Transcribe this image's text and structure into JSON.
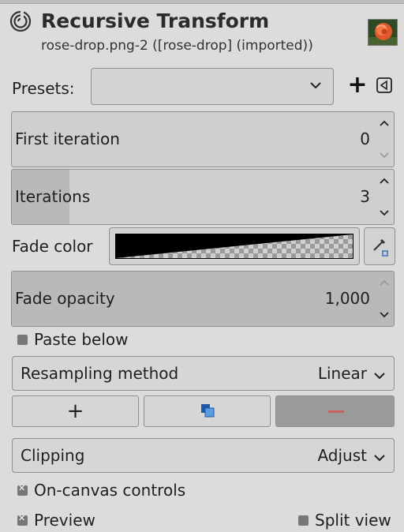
{
  "header": {
    "title": "Recursive Transform",
    "subtitle": "rose-drop.png-2 ([rose-drop] (imported))",
    "tool_icon": "spiral-icon",
    "thumbnail": "rose-thumbnail"
  },
  "presets": {
    "label": "Presets:",
    "value": "",
    "add_label": "+",
    "restore_icon": "restore-icon"
  },
  "first_iteration": {
    "label": "First iteration",
    "value": "0",
    "fraction": 0.0
  },
  "iterations": {
    "label": "Iterations",
    "value": "3",
    "fraction": 0.15
  },
  "fade_color": {
    "label": "Fade color",
    "color": "#000000",
    "picker_icon": "eyedropper-icon"
  },
  "fade_opacity": {
    "label": "Fade opacity",
    "value": "1,000",
    "fraction": 1.0
  },
  "paste_below": {
    "label": "Paste below",
    "checked": false
  },
  "resampling": {
    "label": "Resampling method",
    "value": "Linear"
  },
  "transform_buttons": {
    "add_label": "+",
    "duplicate_icon": "duplicate-icon",
    "remove_icon": "remove-icon"
  },
  "clipping": {
    "label": "Clipping",
    "value": "Adjust"
  },
  "on_canvas_controls": {
    "label": "On-canvas controls",
    "checked": true
  },
  "preview": {
    "label": "Preview",
    "checked": true
  },
  "split_view": {
    "label": "Split view",
    "checked": false
  }
}
